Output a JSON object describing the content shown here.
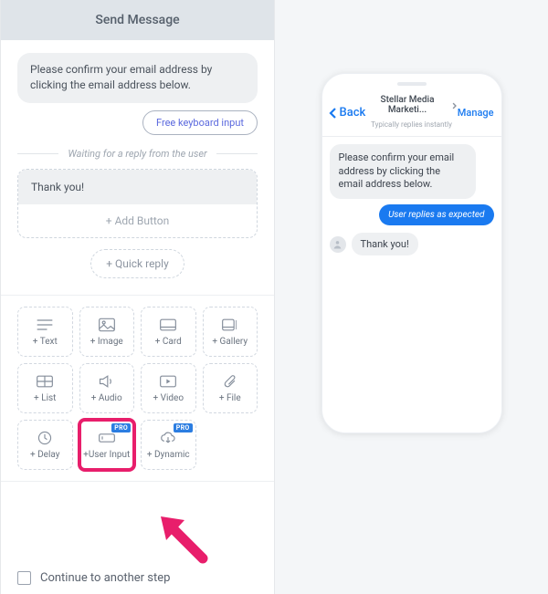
{
  "panel": {
    "title": "Send Message",
    "bubble1": "Please confirm your email address by clicking the email address below.",
    "free_keyboard": "Free keyboard input",
    "waiting_label": "Waiting for a reply from the user",
    "thank_you": "Thank you!",
    "add_button_label": "+ Add Button",
    "quick_reply_label": "+ Quick reply",
    "continue_label": "Continue to another step"
  },
  "blocks": [
    {
      "label": "+ Text",
      "name": "add-text-block"
    },
    {
      "label": "+ Image",
      "name": "add-image-block"
    },
    {
      "label": "+ Card",
      "name": "add-card-block"
    },
    {
      "label": "+ Gallery",
      "name": "add-gallery-block"
    },
    {
      "label": "+ List",
      "name": "add-list-block"
    },
    {
      "label": "+ Audio",
      "name": "add-audio-block"
    },
    {
      "label": "+ Video",
      "name": "add-video-block"
    },
    {
      "label": "+ File",
      "name": "add-file-block"
    },
    {
      "label": "+ Delay",
      "name": "add-delay-block"
    },
    {
      "label": "+User Input",
      "name": "add-user-input-block",
      "pro": "PRO",
      "highlight": true
    },
    {
      "label": "+ Dynamic",
      "name": "add-dynamic-block",
      "pro": "PRO"
    }
  ],
  "preview": {
    "back_label": "Back",
    "title": "Stellar Media Marketi...",
    "subtitle": "Typically replies instantly",
    "manage_label": "Manage",
    "msg1": "Please confirm your email address by clicking the email address below.",
    "msg_user": "User replies as expected",
    "msg2": "Thank you!"
  },
  "colors": {
    "highlight": "#e81e6b",
    "primary": "#1a7af0"
  }
}
